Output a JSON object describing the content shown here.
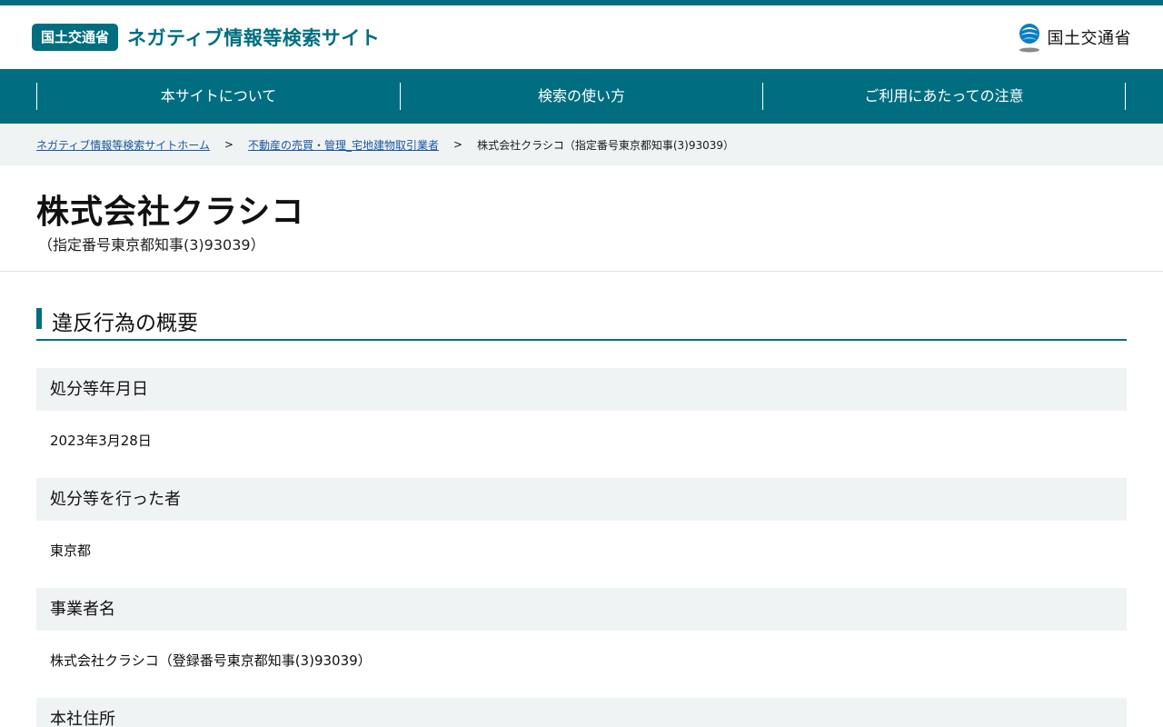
{
  "header": {
    "badge": "国土交通省",
    "site_title": "ネガティブ情報等検索サイト",
    "ministry_name": "国土交通省"
  },
  "nav": {
    "items": [
      {
        "label": "本サイトについて"
      },
      {
        "label": "検索の使い方"
      },
      {
        "label": "ご利用にあたっての注意"
      }
    ]
  },
  "breadcrumb": {
    "home": "ネガティブ情報等検索サイトホーム",
    "sep": ">",
    "category": "不動産の売買・管理_宅地建物取引業者",
    "current": "株式会社クラシコ（指定番号東京都知事(3)93039）"
  },
  "page": {
    "title": "株式会社クラシコ",
    "subtitle": "（指定番号東京都知事(3)93039）"
  },
  "section": {
    "heading": "違反行為の概要",
    "fields": [
      {
        "label": "処分等年月日",
        "value": "2023年3月28日"
      },
      {
        "label": "処分等を行った者",
        "value": "東京都"
      },
      {
        "label": "事業者名",
        "value": "株式会社クラシコ（登録番号東京都知事(3)93039）"
      },
      {
        "label": "本社住所",
        "value": ""
      }
    ]
  },
  "colors": {
    "brand": "#006e80",
    "label_bg": "#f0f3f4",
    "link": "#1a56a0"
  }
}
